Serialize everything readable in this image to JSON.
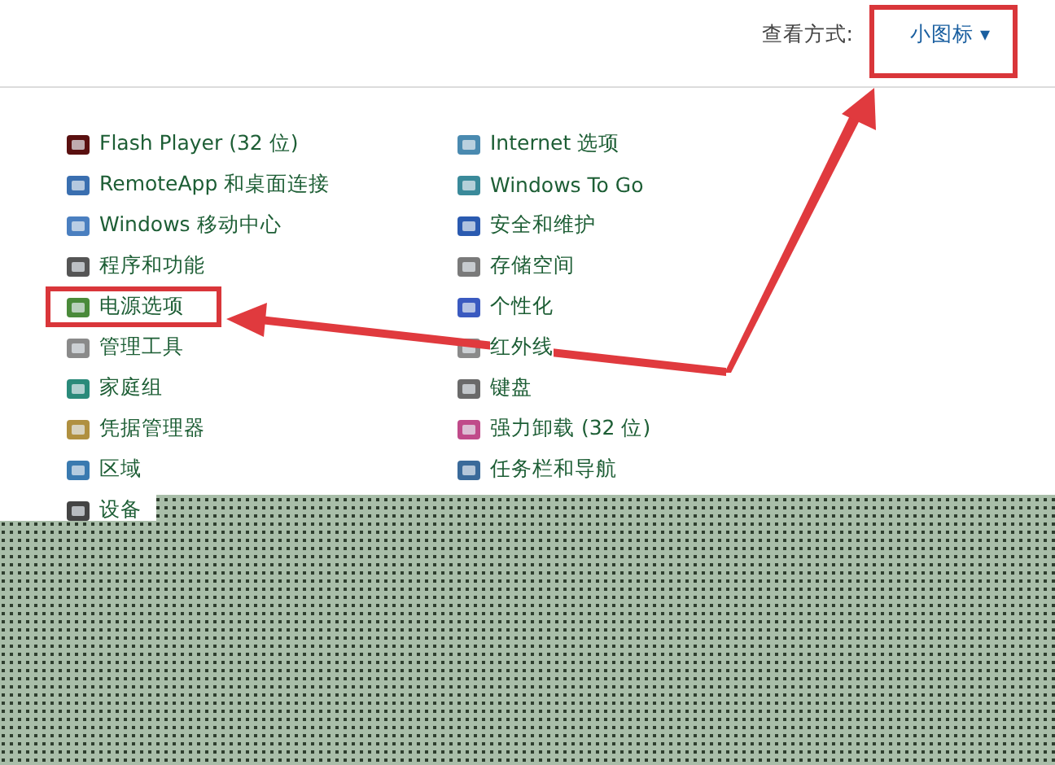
{
  "view_by": {
    "label": "查看方式:",
    "value": "小图标",
    "caret": "▾",
    "highlighted": true
  },
  "columns": [
    {
      "items": [
        {
          "label": "Flash Player (32 位)",
          "highlighted": false
        },
        {
          "label": "RemoteApp 和桌面连接",
          "highlighted": false
        },
        {
          "label": "Windows 移动中心",
          "highlighted": false
        },
        {
          "label": "程序和功能",
          "highlighted": false
        },
        {
          "label": "电源选项",
          "highlighted": true
        },
        {
          "label": "管理工具",
          "highlighted": false
        },
        {
          "label": "家庭组",
          "highlighted": false
        },
        {
          "label": "凭据管理器",
          "highlighted": false
        },
        {
          "label": "区域",
          "highlighted": false
        },
        {
          "label": "设备",
          "highlighted": false
        }
      ]
    },
    {
      "items": [
        {
          "label": "Internet 选项",
          "highlighted": false
        },
        {
          "label": "Windows To Go",
          "highlighted": false
        },
        {
          "label": "安全和维护",
          "highlighted": false
        },
        {
          "label": "存储空间",
          "highlighted": false
        },
        {
          "label": "个性化",
          "highlighted": false
        },
        {
          "label": "红外线",
          "highlighted": false
        },
        {
          "label": "键盘",
          "highlighted": false
        },
        {
          "label": "强力卸载 (32 位)",
          "highlighted": false
        },
        {
          "label": "任务栏和导航",
          "highlighted": false
        }
      ]
    }
  ]
}
